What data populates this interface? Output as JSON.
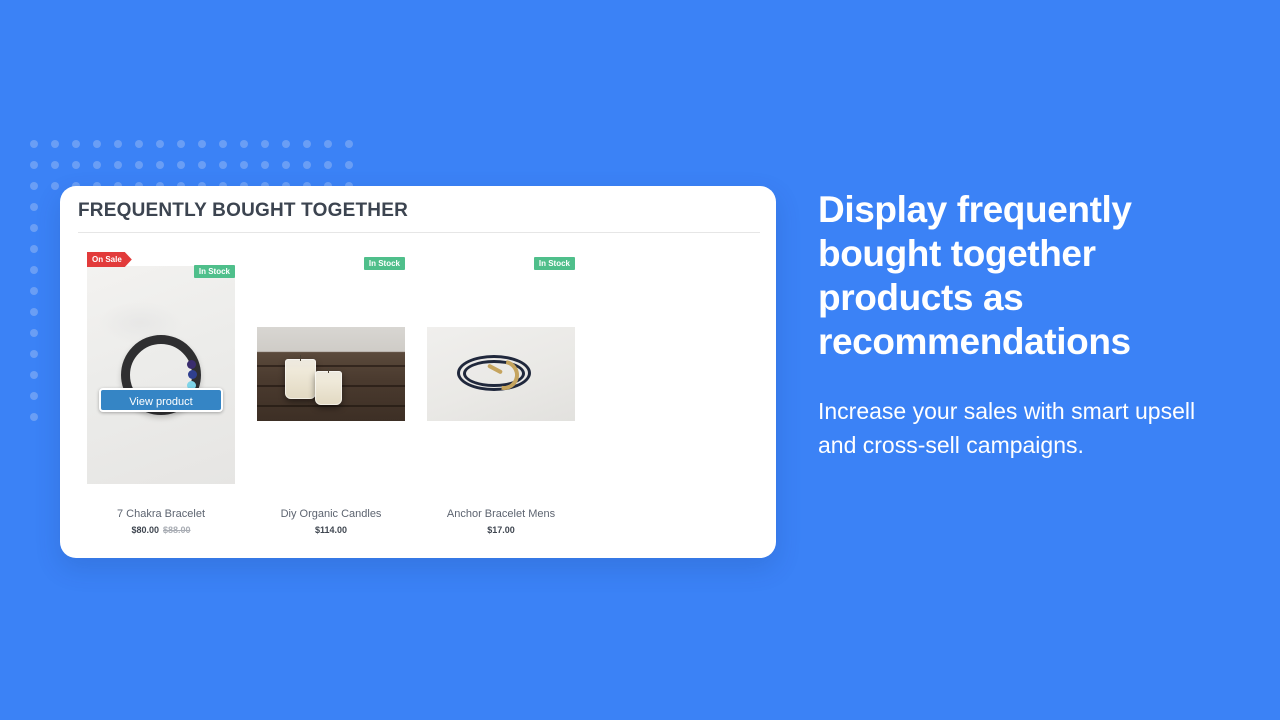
{
  "theme": {
    "background_blue": "#3b82f6",
    "dot_blue": "#6a9ef5",
    "card_white": "#ffffff",
    "button_blue": "#3585c5",
    "sale_red": "#e23b3b",
    "stock_green": "#4fbf8b",
    "title_gray": "#3c4450"
  },
  "widget": {
    "title": "FREQUENTLY BOUGHT TOGETHER",
    "overlay_button_label": "View product",
    "products": [
      {
        "name": "7 Chakra Bracelet",
        "price": "$80.00",
        "compare_at_price": "$88.00",
        "sale_badge": "On Sale",
        "stock_badge": "In Stock",
        "image_alt": "7 chakra black beaded bracelet on marble background",
        "has_overlay_button": true
      },
      {
        "name": "Diy Organic Candles",
        "price": "$114.00",
        "compare_at_price": "",
        "sale_badge": "",
        "stock_badge": "In Stock",
        "image_alt": "Two soy candles in glass jars on dark wood planks",
        "has_overlay_button": false
      },
      {
        "name": "Anchor Bracelet Mens",
        "price": "$17.00",
        "compare_at_price": "",
        "sale_badge": "",
        "stock_badge": "In Stock",
        "image_alt": "Navy leather anchor bracelet with gold hook clasp",
        "has_overlay_button": false
      }
    ]
  },
  "marketing": {
    "headline": "Display frequently bought together products as recommendations",
    "subheadline": "Increase your sales with smart upsell and cross-sell campaigns."
  }
}
